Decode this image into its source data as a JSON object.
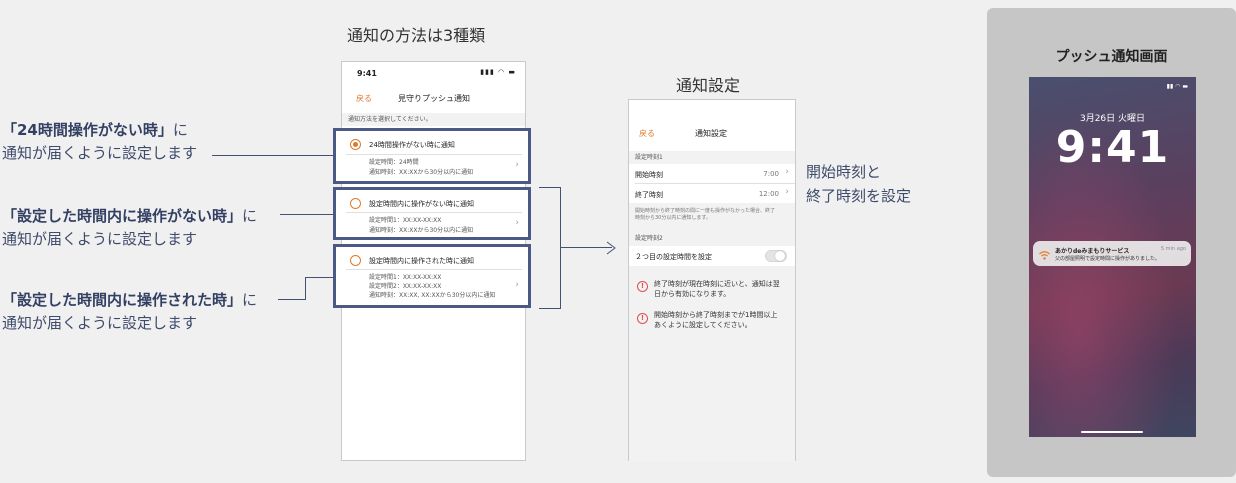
{
  "titles": {
    "methods": "通知の方法は3種類",
    "settings": "通知設定",
    "push": "プッシュ通知画面"
  },
  "notes": [
    {
      "strong": "「24時間操作がない時」",
      "tail": "に",
      "line2": "通知が届くように設定します"
    },
    {
      "strong": "「設定した時間内に操作がない時」",
      "tail": "に",
      "line2": "通知が届くように設定します"
    },
    {
      "strong": "「設定した時間内に操作された時」",
      "tail": "に",
      "line2": "通知が届くように設定します"
    }
  ],
  "settings_note": {
    "line1": "開始時刻と",
    "line2": "終了時刻を設定"
  },
  "screen1": {
    "status_time": "9:41",
    "status_icons": "▮▮▮ ◠ ▬",
    "back": "戻る",
    "title": "見守りプッシュ通知",
    "section": "通知方法を選択してください。",
    "options": [
      {
        "title": "24時間操作がない時に通知",
        "detail1": "設定時間：24時間",
        "detail2": "通知時刻：XX:XXから30分以内に通知",
        "detail3": ""
      },
      {
        "title": "設定時間内に操作がない時に通知",
        "detail1": "設定時間1：XX:XX-XX:XX",
        "detail2": "通知時刻：XX:XXから30分以内に通知",
        "detail3": ""
      },
      {
        "title": "設定時間内に操作された時に通知",
        "detail1": "設定時間1：XX:XX-XX:XX",
        "detail2": "設定時間2：XX:XX-XX:XX",
        "detail3": "通知時刻：XX:XX, XX:XXから30分以内に通知"
      }
    ]
  },
  "screen2": {
    "back": "戻る",
    "title": "通知設定",
    "section1": "設定時刻1",
    "start_label": "開始時刻",
    "start_value": "7:00",
    "end_label": "終了時刻",
    "end_value": "12:00",
    "desc1": "開始時刻から終了時刻の間に一度も操作がなかった場合、終了",
    "desc2": "時刻から30分以内に通知します。",
    "section2": "設定時刻2",
    "toggle_label": "２つ目の設定時間を設定",
    "warnings": [
      {
        "line1": "終了時刻が現在時刻に近いと、通知は翌",
        "line2": "日から有効になります。"
      },
      {
        "line1": "開始時刻から終了時刻までが1時間以上",
        "line2": "あくように設定してください。"
      }
    ]
  },
  "lock": {
    "status_icons": "▮▮ ◠ ▬",
    "date": "3月26日 火曜日",
    "time": "9:41",
    "notif_app": "あかりdeみまもりサービス",
    "notif_body": "父の部屋照明で設定時間に操作がありました。",
    "notif_when": "5 min ago"
  },
  "colors": {
    "accent": "#e07a2b",
    "frame": "#4a5a85",
    "annotation": "#3f4b6b"
  }
}
